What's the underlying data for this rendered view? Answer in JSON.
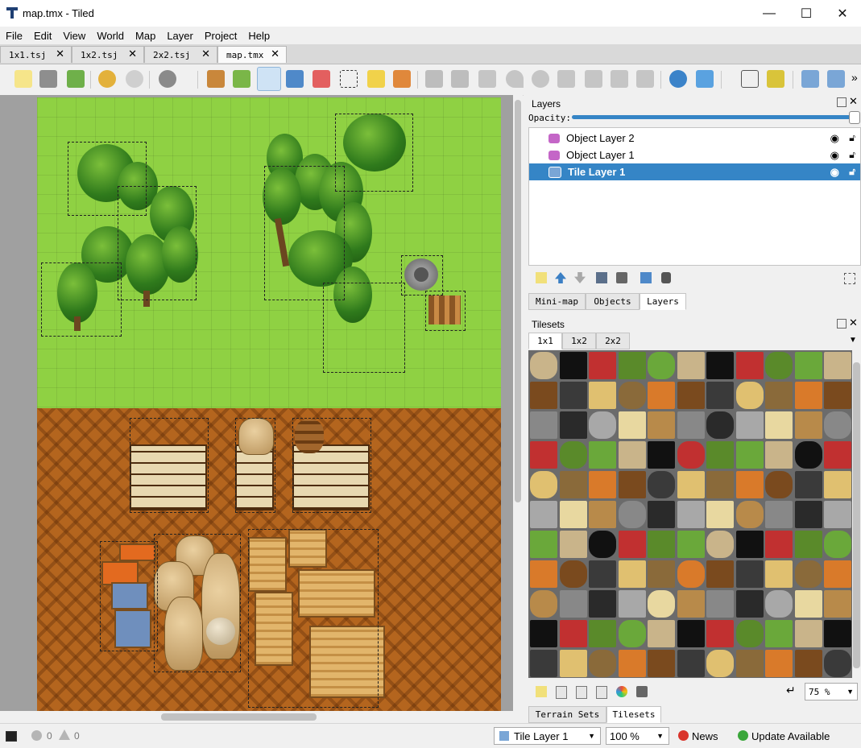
{
  "window": {
    "title": "map.tmx - Tiled",
    "minimize_glyph": "—",
    "maximize_glyph": "☐",
    "close_glyph": "✕"
  },
  "menu": {
    "items": [
      "File",
      "Edit",
      "View",
      "World",
      "Map",
      "Layer",
      "Project",
      "Help"
    ]
  },
  "tabs": [
    {
      "label": "1x1.tsj",
      "close": "✕"
    },
    {
      "label": "1x2.tsj",
      "close": "✕"
    },
    {
      "label": "2x2.tsj",
      "close": "✕"
    },
    {
      "label": "map.tmx",
      "close": "✕"
    }
  ],
  "toolbar": {
    "icons": [
      "new-map-icon",
      "open-icon",
      "save-icon",
      "undo-icon",
      "redo-icon",
      "commands-icon",
      "stamp-brush-icon",
      "terrain-brush-icon",
      "bucket-fill-icon",
      "shape-fill-icon",
      "eraser-icon",
      "rect-select-icon",
      "magic-wand-icon",
      "select-same-tile-icon",
      "select-objects-icon",
      "edit-polygons-icon",
      "insert-rectangle-icon",
      "insert-point-icon",
      "insert-ellipse-icon",
      "insert-polygon-icon",
      "insert-tile-icon",
      "insert-template-icon",
      "insert-text-icon",
      "world-tool-icon",
      "move-icon",
      "random-mode-icon",
      "wang-fill-icon",
      "flip-horizontal-icon",
      "flip-vertical-icon"
    ],
    "overflow": "»"
  },
  "layers_panel": {
    "title": "Layers",
    "opacity_label": "Opacity:",
    "layers": [
      {
        "name": "Object Layer 2",
        "type": "object"
      },
      {
        "name": "Object Layer 1",
        "type": "object"
      },
      {
        "name": "Tile Layer 1",
        "type": "tile",
        "selected": true
      }
    ],
    "tabs": [
      "Mini-map",
      "Objects",
      "Layers"
    ]
  },
  "tilesets_panel": {
    "title": "Tilesets",
    "tabs": [
      "1x1",
      "1x2",
      "2x2"
    ],
    "zoom": "75 %"
  },
  "bottom_tabs": [
    "Terrain Sets",
    "Tilesets"
  ],
  "status": {
    "errors": "0",
    "warnings": "0",
    "layer": "Tile Layer 1",
    "zoom": "100 %",
    "news": "News",
    "update": "Update Available"
  },
  "colors": {
    "selection": "#3585c6",
    "grass": "#8fd143",
    "dirt": "#b4651e"
  }
}
